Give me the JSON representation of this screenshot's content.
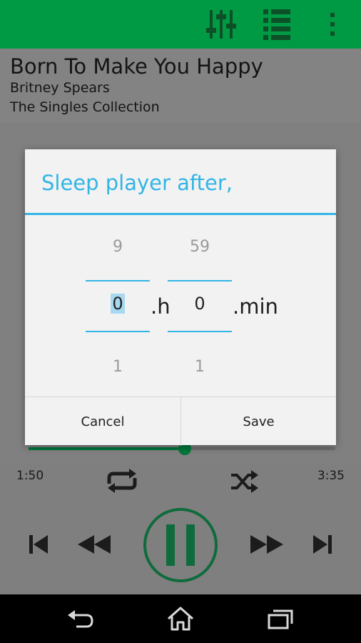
{
  "colors": {
    "accent": "#009a44",
    "dialog_accent": "#33b5e5",
    "play_green": "#0f6b3c"
  },
  "toolbar": {
    "icons": [
      "equalizer-icon",
      "playlist-icon",
      "overflow-menu-icon"
    ]
  },
  "track": {
    "title": "Born To Make You Happy",
    "artist": "Britney Spears",
    "album": "The Singles Collection"
  },
  "playback": {
    "elapsed": "1:50",
    "duration": "3:35",
    "progress_fraction": 0.51
  },
  "dialog": {
    "title": "Sleep player after,",
    "hours": {
      "prev": "9",
      "current": "0",
      "next": "1",
      "unit": ".h"
    },
    "minutes": {
      "prev": "59",
      "current": "0",
      "next": "1",
      "unit": ".min"
    },
    "cancel_label": "Cancel",
    "save_label": "Save"
  },
  "navbar": {
    "icons": [
      "back-icon",
      "home-icon",
      "recents-icon"
    ]
  }
}
